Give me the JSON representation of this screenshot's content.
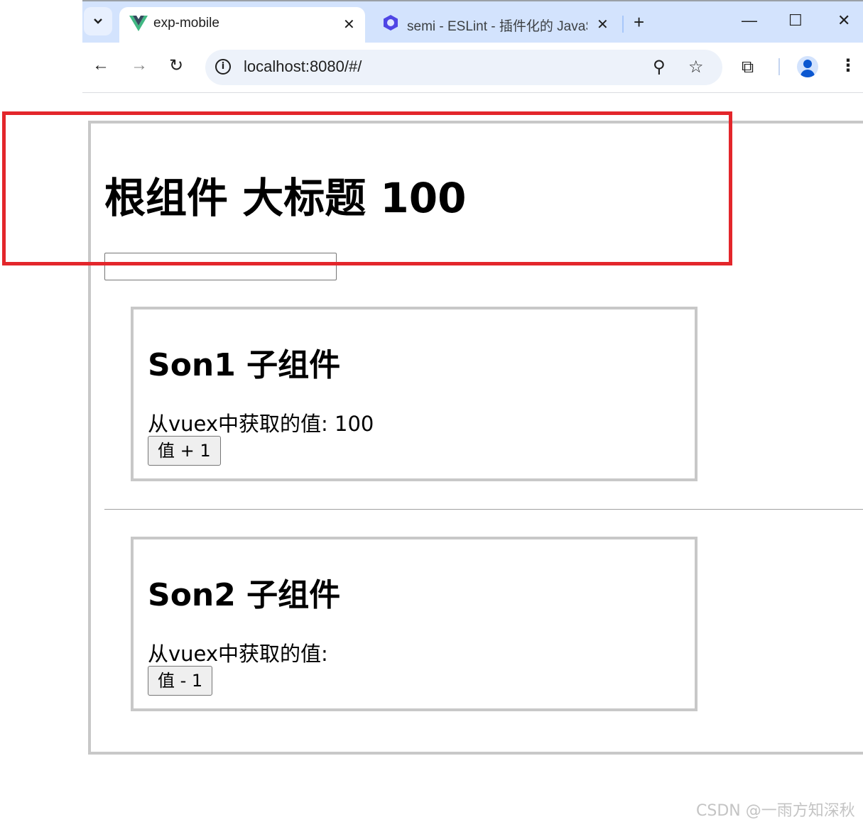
{
  "browser": {
    "tabs": [
      {
        "title": "exp-mobile",
        "active": true,
        "close": "✕"
      },
      {
        "title": "semi - ESLint - 插件化的 JavaScript",
        "active": false,
        "close": "✕"
      }
    ],
    "new_tab": "+",
    "window": {
      "minimize": "—",
      "maximize": "☐",
      "close": "✕"
    },
    "nav": {
      "back": "←",
      "forward": "→",
      "reload": "↻"
    },
    "url": "localhost:8080/#/",
    "info": "i",
    "zoom_icon": "⚲",
    "bookmark_icon": "☆",
    "extensions_icon": "⧉",
    "menu_icon": "⋮",
    "accent_color": "#d3e3fd"
  },
  "page": {
    "root": {
      "title": "根组件 大标题 100",
      "input_value": ""
    },
    "son1": {
      "title": "Son1 子组件",
      "value_text": "从vuex中获取的值: 100",
      "button_label": "值 + 1"
    },
    "son2": {
      "title": "Son2 子组件",
      "value_text": "从vuex中获取的值:",
      "button_label": "值 - 1"
    },
    "highlight_color": "#e3262b"
  },
  "watermark": "CSDN @一雨方知深秋"
}
